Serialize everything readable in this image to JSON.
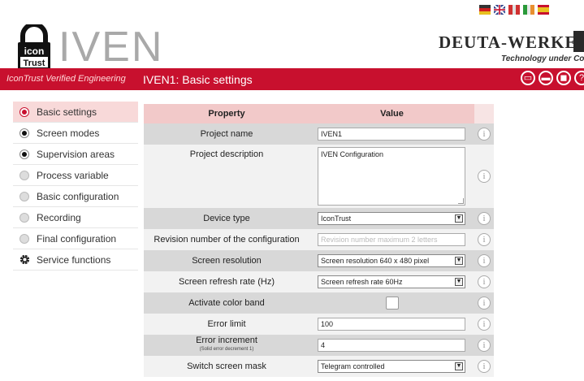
{
  "header": {
    "logo_top": "icon",
    "logo_bottom": "Trust",
    "logo_text": "IVEN",
    "company": "DEUTA-WERKE",
    "tagline": "Technology under Control",
    "redbar_tag": "IconTrust Verified Engineering",
    "page_title": "IVEN1: Basic settings",
    "languages": [
      "german-flag-icon",
      "uk-flag-icon",
      "italian-flag-icon",
      "irish-flag-icon",
      "spanish-flag-icon"
    ],
    "actions": [
      "new-file-icon",
      "open-folder-icon",
      "save-icon",
      "help-icon"
    ],
    "colors": {
      "brand": "#c8102e",
      "header_highlight": "#f2c9c9"
    }
  },
  "sidebar": {
    "items": [
      {
        "label": "Basic settings",
        "state": "active"
      },
      {
        "label": "Screen modes",
        "state": "done"
      },
      {
        "label": "Supervision areas",
        "state": "done"
      },
      {
        "label": "Process variable",
        "state": "pending"
      },
      {
        "label": "Basic configuration",
        "state": "pending"
      },
      {
        "label": "Recording",
        "state": "pending"
      },
      {
        "label": "Final configuration",
        "state": "pending"
      },
      {
        "label": "Service functions",
        "state": "service"
      }
    ]
  },
  "table": {
    "col_property": "Property",
    "col_value": "Value",
    "rows": [
      {
        "property": "Project name",
        "value": "IVEN1"
      },
      {
        "property": "Project description",
        "value": "IVEN Configuration"
      },
      {
        "property": "Device type",
        "value": "IconTrust"
      },
      {
        "property": "Revision number of the configuration",
        "placeholder": "Revision number maximum 2 letters"
      },
      {
        "property": "Screen resolution",
        "value": "Screen resolution 640 x 480 pixel"
      },
      {
        "property": "Screen refresh rate (Hz)",
        "value": "Screen refresh rate 60Hz"
      },
      {
        "property": "Activate color band",
        "checked": false
      },
      {
        "property": "Error limit",
        "value": "100"
      },
      {
        "property": "Error increment",
        "note": "(Solid error decrement 1)",
        "value": "4"
      },
      {
        "property": "Switch screen mask",
        "value": "Telegram controlled"
      }
    ],
    "info_symbol": "i",
    "dropdown_arrow": "▼"
  }
}
